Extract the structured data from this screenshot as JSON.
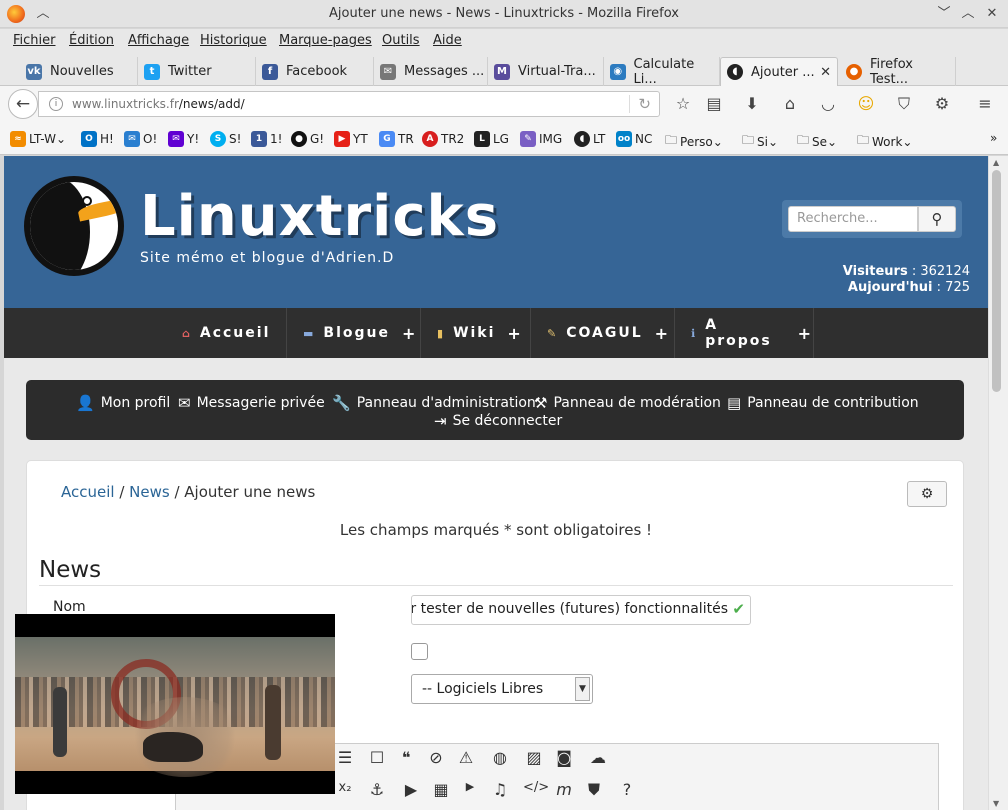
{
  "window": {
    "title": "Ajouter une news - News - Linuxtricks - Mozilla Firefox"
  },
  "menubar": [
    "Fichier",
    "Édition",
    "Affichage",
    "Historique",
    "Marque-pages",
    "Outils",
    "Aide"
  ],
  "tabs": [
    {
      "label": "Nouvelles",
      "icon": "vk-icon",
      "color": "#4a76a8"
    },
    {
      "label": "Twitter",
      "icon": "twitter-icon",
      "color": "#1da1f2"
    },
    {
      "label": "Facebook",
      "icon": "facebook-icon",
      "color": "#3b5998"
    },
    {
      "label": "Messages ...",
      "icon": "messages-icon",
      "color": "#666666"
    },
    {
      "label": "Virtual-Tra...",
      "icon": "virtual-icon",
      "color": "#5a4d9c"
    },
    {
      "label": "Calculate Li...",
      "icon": "calculate-icon",
      "color": "#2c7bc0"
    },
    {
      "label": "Ajouter ...",
      "icon": "linuxtricks-icon",
      "color": "#222222",
      "active": true
    },
    {
      "label": "Firefox Test...",
      "icon": "firefox-icon",
      "color": "#e66000"
    }
  ],
  "navbar": {
    "url_host": "www.linuxtricks.fr",
    "url_path": "/news/add/"
  },
  "bookmarks": [
    "LT-W",
    "H!",
    "O!",
    "Y!",
    "S!",
    "1!",
    "G!",
    "YT",
    "TR",
    "TR2",
    "LG",
    "IMG",
    "LT",
    "NC",
    "Perso",
    "Si",
    "Se",
    "Work"
  ],
  "site": {
    "name": "Linuxtricks",
    "tagline": "Site mémo et blogue d'Adrien.D",
    "search_placeholder": "Recherche...",
    "visitors_label": "Visiteurs",
    "visitors_value": "362124",
    "today_label": "Aujourd'hui",
    "today_value": "725"
  },
  "mainnav": [
    {
      "label": "Accueil",
      "plus": false
    },
    {
      "label": "Blogue",
      "plus": true
    },
    {
      "label": "Wiki",
      "plus": true
    },
    {
      "label": "COAGUL",
      "plus": true
    },
    {
      "label": "A propos",
      "plus": true
    }
  ],
  "usermenu": {
    "profile": "Mon profil",
    "messages": "Messagerie privée",
    "admin": "Panneau d'administration",
    "moderation": "Panneau de modération",
    "contribution": "Panneau de contribution",
    "logout": "Se déconnecter"
  },
  "content": {
    "crumb_home": "Accueil",
    "crumb_news": "News",
    "crumb_current": "Ajouter une news",
    "required_note": "Les champs marqués * sont obligatoires !",
    "section_title": "News",
    "name_label": "Nom",
    "title_value": "our tester de nouvelles (futures) fonctionnalités",
    "category_value": "-- Logiciels Libres"
  }
}
